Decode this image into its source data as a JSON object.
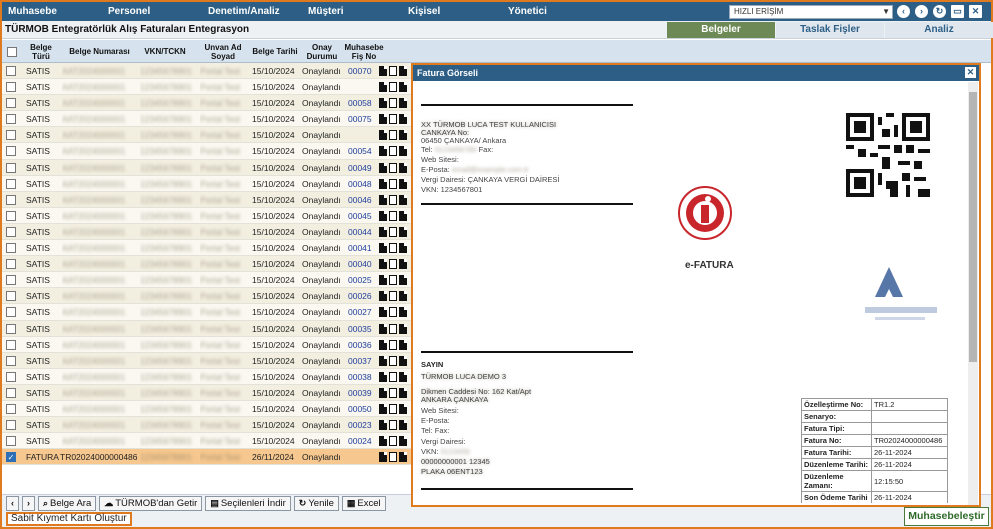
{
  "nav": {
    "items": [
      "Muhasebe",
      "Personel",
      "Denetim/Analiz",
      "Müşteri",
      "Kişisel",
      "Yönetici"
    ],
    "quick_access": "HIZLI ERİŞİM"
  },
  "title": "TÜRMOB Entegratörlük Alış Faturaları Entegrasyon",
  "tabs": [
    "Belgeler",
    "Taslak Fişler",
    "Analiz"
  ],
  "table": {
    "headers": {
      "type": "Belge Türü",
      "number": "Belge Numarası",
      "vkn": "VKN/TCKN",
      "name": "Unvan Ad Soyad",
      "date": "Belge Tarihi",
      "status": "Onay Durumu",
      "voucher": "Muhasebe Fiş No"
    },
    "rows": [
      {
        "type": "SATIS",
        "date": "15/10/2024",
        "status": "Onaylandı",
        "voucher": "00070"
      },
      {
        "type": "SATIS",
        "date": "15/10/2024",
        "status": "Onaylandı",
        "voucher": ""
      },
      {
        "type": "SATIS",
        "date": "15/10/2024",
        "status": "Onaylandı",
        "voucher": "00058"
      },
      {
        "type": "SATIS",
        "date": "15/10/2024",
        "status": "Onaylandı",
        "voucher": "00075"
      },
      {
        "type": "SATIS",
        "date": "15/10/2024",
        "status": "Onaylandı",
        "voucher": ""
      },
      {
        "type": "SATIS",
        "date": "15/10/2024",
        "status": "Onaylandı",
        "voucher": "00054"
      },
      {
        "type": "SATIS",
        "date": "15/10/2024",
        "status": "Onaylandı",
        "voucher": "00049"
      },
      {
        "type": "SATIS",
        "date": "15/10/2024",
        "status": "Onaylandı",
        "voucher": "00048"
      },
      {
        "type": "SATIS",
        "date": "15/10/2024",
        "status": "Onaylandı",
        "voucher": "00046"
      },
      {
        "type": "SATIS",
        "date": "15/10/2024",
        "status": "Onaylandı",
        "voucher": "00045"
      },
      {
        "type": "SATIS",
        "date": "15/10/2024",
        "status": "Onaylandı",
        "voucher": "00044"
      },
      {
        "type": "SATIS",
        "date": "15/10/2024",
        "status": "Onaylandı",
        "voucher": "00041"
      },
      {
        "type": "SATIS",
        "date": "15/10/2024",
        "status": "Onaylandı",
        "voucher": "00040"
      },
      {
        "type": "SATIS",
        "date": "15/10/2024",
        "status": "Onaylandı",
        "voucher": "00025"
      },
      {
        "type": "SATIS",
        "date": "15/10/2024",
        "status": "Onaylandı",
        "voucher": "00026"
      },
      {
        "type": "SATIS",
        "date": "15/10/2024",
        "status": "Onaylandı",
        "voucher": "00027"
      },
      {
        "type": "SATIS",
        "date": "15/10/2024",
        "status": "Onaylandı",
        "voucher": "00035"
      },
      {
        "type": "SATIS",
        "date": "15/10/2024",
        "status": "Onaylandı",
        "voucher": "00036"
      },
      {
        "type": "SATIS",
        "date": "15/10/2024",
        "status": "Onaylandı",
        "voucher": "00037"
      },
      {
        "type": "SATIS",
        "date": "15/10/2024",
        "status": "Onaylandı",
        "voucher": "00038"
      },
      {
        "type": "SATIS",
        "date": "15/10/2024",
        "status": "Onaylandı",
        "voucher": "00039"
      },
      {
        "type": "SATIS",
        "date": "15/10/2024",
        "status": "Onaylandı",
        "voucher": "00050"
      },
      {
        "type": "SATIS",
        "date": "15/10/2024",
        "status": "Onaylandı",
        "voucher": "00023"
      },
      {
        "type": "SATIS",
        "date": "15/10/2024",
        "status": "Onaylandı",
        "voucher": "00024"
      },
      {
        "type": "FATURA",
        "number": "TR02024000000486",
        "date": "26/11/2024",
        "status": "Onaylandı",
        "voucher": "",
        "selected": true
      }
    ]
  },
  "toolbar": {
    "search": "Belge Ara",
    "fetch": "TÜRMOB'dan Getir",
    "download": "Seçilenleri İndir",
    "refresh": "Yenile",
    "excel": "Excel"
  },
  "footer": {
    "fixed_asset": "Sabit Kıymet Kartı Oluştur",
    "post": "Muhasebeleştir"
  },
  "popup": {
    "title": "Fatura Görseli",
    "seller": {
      "address": "06450 ÇANKAYA/ Ankara",
      "tel": "Tel:",
      "fax": "Fax:",
      "web": "Web Sitesi:",
      "email": "E-Posta:",
      "tax_office": "Vergi Dairesi: ÇANKAYA VERGİ DAİRESİ",
      "vkn": "VKN: 1234567801"
    },
    "efatura": "e-FATURA",
    "buyer": {
      "heading": "SAYIN",
      "web": "Web Sitesi:",
      "email": "E-Posta:",
      "telfax": "Tel: Fax:",
      "tax_office": "Vergi Dairesi:",
      "vkn": "VKN:"
    },
    "meta": [
      {
        "k": "Özelleştirme No:",
        "v": "TR1.2"
      },
      {
        "k": "Senaryo:",
        "v": ""
      },
      {
        "k": "Fatura Tipi:",
        "v": ""
      },
      {
        "k": "Fatura No:",
        "v": "TR02024000000486"
      },
      {
        "k": "Fatura Tarihi:",
        "v": "26-11-2024"
      },
      {
        "k": "Düzenleme Tarihi:",
        "v": "26-11-2024"
      },
      {
        "k": "Düzenleme Zamanı:",
        "v": "12:15:50"
      },
      {
        "k": "Son Ödeme Tarihi",
        "v": "26-11-2024"
      }
    ]
  }
}
